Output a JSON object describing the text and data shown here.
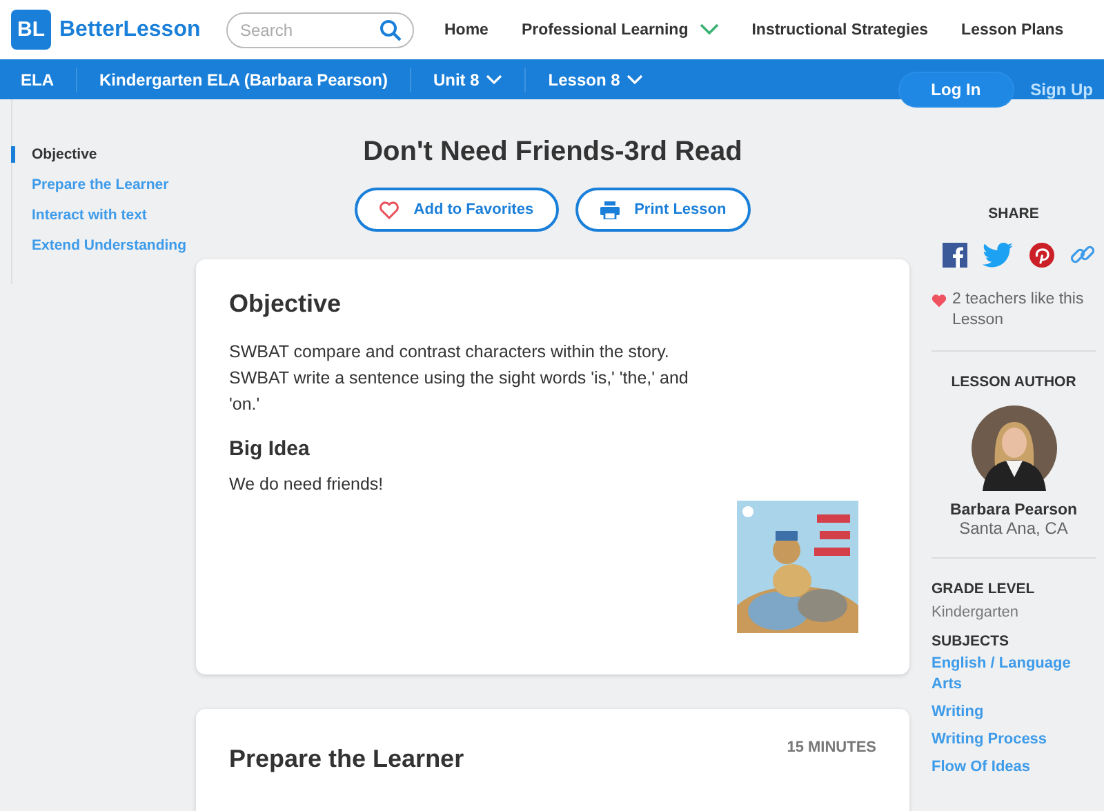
{
  "logo": {
    "mark": "BL",
    "name": "BetterLesson"
  },
  "search": {
    "placeholder": "Search"
  },
  "top_nav": [
    {
      "label": "Home",
      "has_menu": false
    },
    {
      "label": "Professional Learning",
      "has_menu": true
    },
    {
      "label": "Instructional Strategies",
      "has_menu": false
    },
    {
      "label": "Lesson Plans",
      "has_menu": false
    }
  ],
  "breadcrumb": [
    {
      "label": "ELA",
      "has_menu": false
    },
    {
      "label": "Kindergarten ELA (Barbara Pearson)",
      "has_menu": false
    },
    {
      "label": "Unit 8",
      "has_menu": true
    },
    {
      "label": "Lesson 8",
      "has_menu": true
    }
  ],
  "auth": {
    "login": "Log In",
    "signup": "Sign Up"
  },
  "sidebar": {
    "items": [
      {
        "label": "Objective",
        "selected": true
      },
      {
        "label": "Prepare the Learner",
        "selected": false
      },
      {
        "label": "Interact with text",
        "selected": false
      },
      {
        "label": "Extend Understanding",
        "selected": false
      }
    ]
  },
  "lesson": {
    "title": "Don't Need Friends-3rd Read",
    "actions": [
      {
        "label": "Add to Favorites",
        "kind": "favorite"
      },
      {
        "label": "Print Lesson",
        "kind": "print"
      }
    ],
    "objective": {
      "heading": "Objective",
      "lines": [
        "SWBAT compare and contrast characters within the story.",
        "SWBAT write a sentence using the sight words 'is,'  'the,' and 'on.'"
      ],
      "big_idea_heading": "Big Idea",
      "big_idea": "We do need friends!"
    },
    "next_section": {
      "heading": "Prepare the Learner",
      "duration": "15 MINUTES"
    }
  },
  "share": {
    "title": "SHARE",
    "networks": [
      {
        "kind": "facebook"
      },
      {
        "kind": "twitter"
      },
      {
        "kind": "pinterest"
      },
      {
        "kind": "link"
      }
    ]
  },
  "likes": "2 teachers like this Lesson",
  "author": {
    "title": "LESSON AUTHOR",
    "name": "Barbara Pearson",
    "location": "Santa Ana, CA"
  },
  "grade": {
    "title": "GRADE LEVEL",
    "value": "Kindergarten"
  },
  "subjects": {
    "title": "SUBJECTS",
    "items": [
      "English / Language Arts",
      "Writing",
      "Writing Process",
      "Flow Of Ideas"
    ]
  }
}
